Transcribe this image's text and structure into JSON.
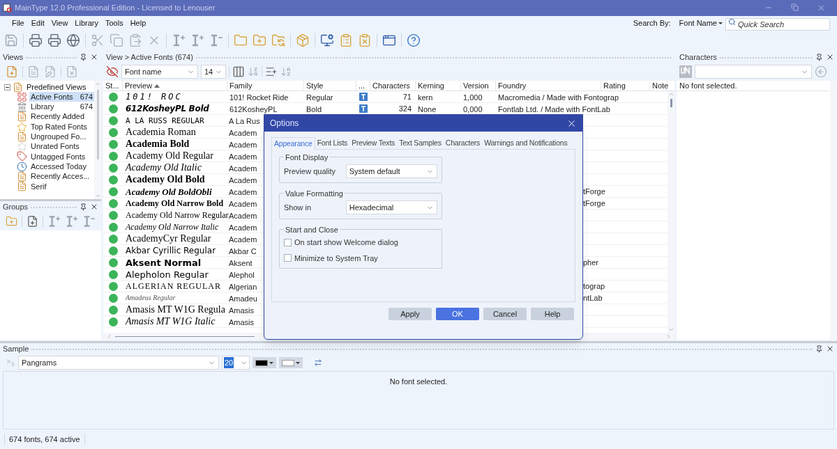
{
  "window": {
    "title": "MainType 12.0 Professional Edition - Licensed to Lenouser"
  },
  "menu": [
    "File",
    "Edit",
    "View",
    "Library",
    "Tools",
    "Help"
  ],
  "search": {
    "label": "Search By:",
    "field": "Font Name",
    "placeholder": "Quick Search"
  },
  "views_panel": {
    "title": "Views",
    "tree": [
      {
        "label": "Predefined Views",
        "expanded": true,
        "children": [
          {
            "label": "Active Fonts",
            "count": "674",
            "selected": true
          },
          {
            "label": "Library",
            "count": "674",
            "selected": false
          },
          {
            "label": "Recently Added",
            "selected": false
          },
          {
            "label": "Top Rated Fonts",
            "selected": false
          },
          {
            "label": "Ungrouped Fo...",
            "selected": false
          },
          {
            "label": "Unrated Fonts",
            "selected": false
          },
          {
            "label": "Untagged Fonts",
            "selected": false
          },
          {
            "label": "Accessed Today",
            "selected": false
          },
          {
            "label": "Recently Acces...",
            "selected": false
          },
          {
            "label": "Serif",
            "selected": false
          }
        ]
      }
    ]
  },
  "groups_panel": {
    "title": "Groups"
  },
  "font_list": {
    "breadcrumb": "View > Active Fonts (674)",
    "name_field": "Font name",
    "size_field": "14",
    "columns": [
      "St...",
      "Preview",
      "Family",
      "Style",
      "...",
      "Characters",
      "Kerning",
      "Version",
      "Foundry",
      "Rating",
      "Note"
    ],
    "rows": [
      {
        "active": true,
        "kind": "decorative",
        "preview": "101! ROC",
        "family": "101! Rocket Ride",
        "style": "Regular",
        "characters": "71",
        "kerning": "kern",
        "version": "1,000",
        "foundry": "Macromedia / Made with Fontograp"
      },
      {
        "active": true,
        "kind": "brush",
        "preview": "612KosheyPL Bold",
        "family": "612KosheyPL",
        "style": "Bold",
        "characters": "324",
        "kerning": "None",
        "version": "0,000",
        "foundry": "Fontlab Ltd. / Made with FontLab"
      },
      {
        "active": true,
        "kind": "caps-mono",
        "preview": "A LA RUSS REGULAR",
        "family": "A La Rus"
      },
      {
        "active": true,
        "kind": "serif",
        "preview": "Academia Roman",
        "family": "Academ"
      },
      {
        "active": true,
        "kind": "serif-bold",
        "preview": "Academia Bold",
        "family": "Academ"
      },
      {
        "active": true,
        "kind": "serif",
        "preview": "Academy Old Regular",
        "family": "Academ"
      },
      {
        "active": true,
        "kind": "serif-italic",
        "preview": "Academy Old Italic",
        "family": "Academ"
      },
      {
        "active": true,
        "kind": "serif-bold",
        "preview": "Academy Old Bold",
        "family": "Academ"
      },
      {
        "active": true,
        "kind": "serif-bold-italic",
        "preview": "Academy Old BoldObli",
        "family": "Academ",
        "foundry": "tForge"
      },
      {
        "active": true,
        "kind": "narrow-bold",
        "preview": "Academy Old Narrow Bold",
        "family": "Academ",
        "foundry": "tForge"
      },
      {
        "active": true,
        "kind": "narrow",
        "preview": "Academy Old Narrow Regular",
        "family": "Academ"
      },
      {
        "active": true,
        "kind": "narrow-italic",
        "preview": "Academy Old Narrow Italic",
        "family": "Academ"
      },
      {
        "active": true,
        "kind": "serif",
        "preview": "AcademyCyr Regular",
        "family": "Academ"
      },
      {
        "active": true,
        "kind": "hand",
        "preview": "Akbar Cyrillic Regular",
        "family": "Akbar C"
      },
      {
        "active": true,
        "kind": "black",
        "preview": "Aksent Normal",
        "family": "Aksent",
        "foundry": "pher"
      },
      {
        "active": true,
        "kind": "geometric",
        "preview": "Alepholon Regular",
        "family": "Alephol"
      },
      {
        "active": true,
        "kind": "caps-serif",
        "preview": "ALGERIAN REGULAR",
        "family": "Algerian",
        "foundry": "tograp"
      },
      {
        "active": true,
        "kind": "script",
        "preview": "Amadeus Regular",
        "family": "Amadeu",
        "foundry": "ntLab"
      },
      {
        "active": true,
        "kind": "serif",
        "preview": "Amasis MT W1G Regula",
        "family": "Amasis"
      },
      {
        "active": true,
        "kind": "serif-italic",
        "preview": "Amasis MT W1G Italic",
        "family": "Amasis"
      }
    ]
  },
  "characters_panel": {
    "title": "Characters",
    "message": "No font selected."
  },
  "sample_panel": {
    "title": "Sample",
    "text_set": "Pangrams",
    "size": "20",
    "swatches": [
      {
        "color": "#000000"
      },
      {
        "color": "#ffffff"
      }
    ],
    "message": "No font selected."
  },
  "status_bar": [
    "674 fonts, 674 active"
  ],
  "dialog": {
    "title": "Options",
    "tabs": [
      {
        "label": "Appearance",
        "selected": true
      },
      {
        "label": "Font Lists",
        "selected": false
      },
      {
        "label": "Preview Texts",
        "selected": false
      },
      {
        "label": "Text Samples",
        "selected": false
      },
      {
        "label": "Characters",
        "selected": false
      },
      {
        "label": "Warnings and Notifications",
        "selected": false
      }
    ],
    "groups": [
      {
        "title": "Font Display",
        "kind": "select",
        "label": "Preview quality",
        "value": "System default"
      },
      {
        "title": "Value Formatting",
        "kind": "select",
        "label": "Show in",
        "value": "Hexadecimal"
      },
      {
        "title": "Start and Close",
        "kind": "checkboxes",
        "items": [
          {
            "label": "On start show Welcome dialog",
            "checked": false
          },
          {
            "label": "Minimize to System Tray",
            "checked": false
          }
        ]
      }
    ],
    "buttons": [
      {
        "label": "Apply",
        "primary": false
      },
      {
        "label": "OK",
        "primary": true
      },
      {
        "label": "Cancel",
        "primary": false
      },
      {
        "label": "Help",
        "primary": false
      }
    ]
  }
}
